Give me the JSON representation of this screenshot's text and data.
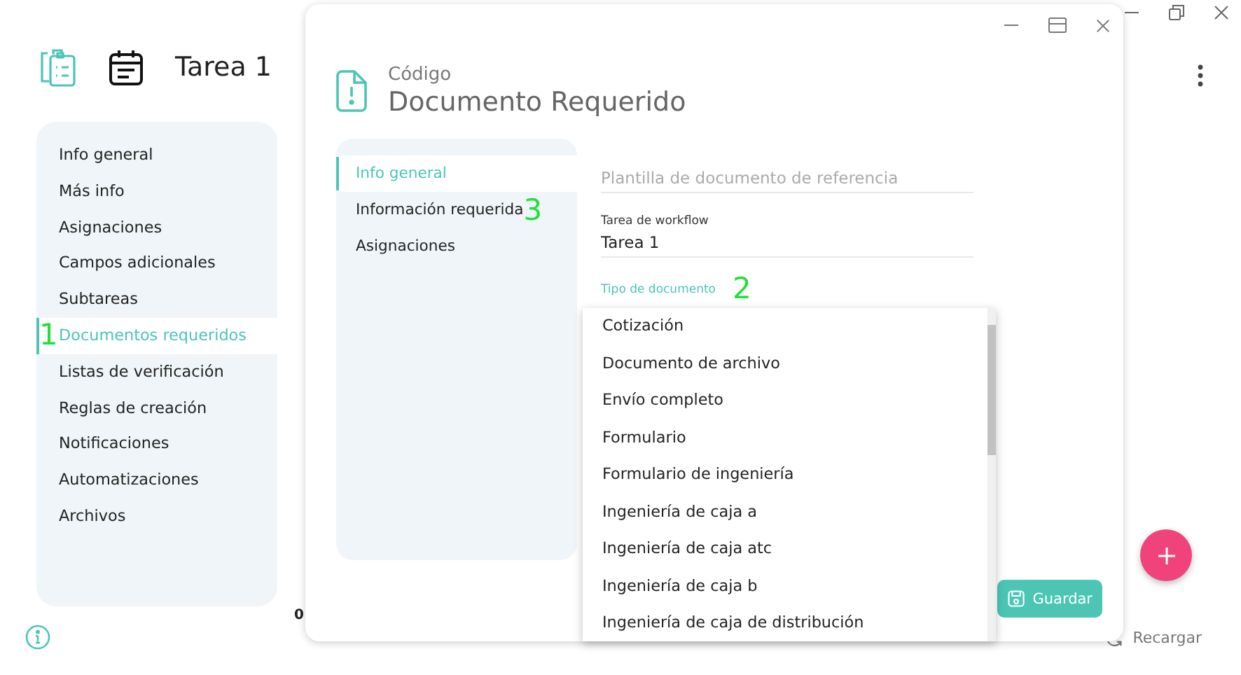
{
  "app": {
    "title": "Tarea 1",
    "sidebar": [
      {
        "label": "Info general",
        "selected": false
      },
      {
        "label": "Más info",
        "selected": false
      },
      {
        "label": "Asignaciones",
        "selected": false
      },
      {
        "label": "Campos adicionales",
        "selected": false
      },
      {
        "label": "Subtareas",
        "selected": false
      },
      {
        "label": "Documentos requeridos",
        "selected": true,
        "marker": "1"
      },
      {
        "label": "Listas de verificación",
        "selected": false
      },
      {
        "label": "Reglas de creación",
        "selected": false
      },
      {
        "label": "Notificaciones",
        "selected": false
      },
      {
        "label": "Automatizaciones",
        "selected": false
      },
      {
        "label": "Archivos",
        "selected": false
      }
    ],
    "cell_peek": "0",
    "reload": "Recargar"
  },
  "dialog": {
    "subtitle": "Código",
    "title": "Documento Requerido",
    "nav": [
      {
        "label": "Info general",
        "selected": true
      },
      {
        "label": "Información requerida",
        "selected": false,
        "marker": "3"
      },
      {
        "label": "Asignaciones",
        "selected": false
      }
    ],
    "template_field": {
      "placeholder": "Plantilla de documento de referencia"
    },
    "task_field": {
      "label": "Tarea de workflow",
      "value": "Tarea 1"
    },
    "type_field": {
      "label": "Tipo de documento",
      "focused": true,
      "marker": "2",
      "options": [
        "Cotización",
        "Documento de archivo",
        "Envío completo",
        "Formulario",
        "Formulario de ingeniería",
        "Ingeniería de caja a",
        "Ingeniería de caja atc",
        "Ingeniería de caja b",
        "Ingeniería de caja de distribución"
      ]
    },
    "save": "Guardar"
  }
}
